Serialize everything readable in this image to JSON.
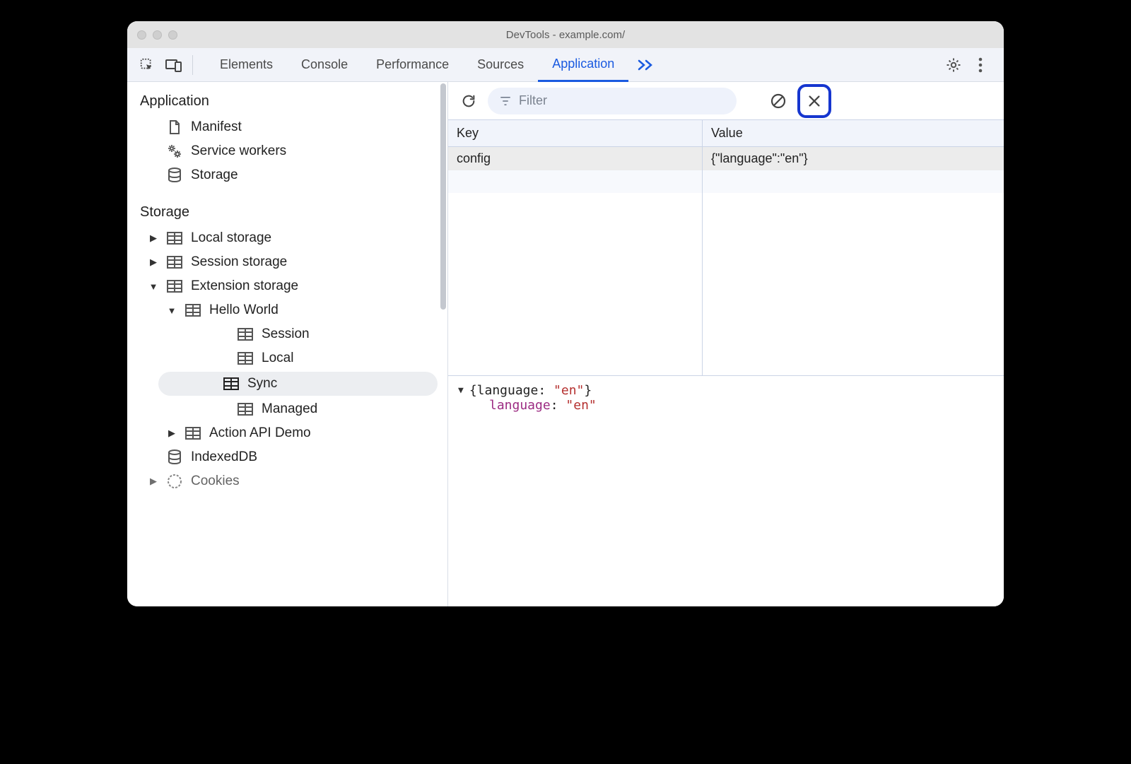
{
  "window": {
    "title": "DevTools - example.com/"
  },
  "tabs": {
    "items": [
      "Elements",
      "Console",
      "Performance",
      "Sources",
      "Application"
    ],
    "active": "Application"
  },
  "sidebar": {
    "sections": {
      "application": {
        "title": "Application",
        "items": [
          {
            "label": "Manifest"
          },
          {
            "label": "Service workers"
          },
          {
            "label": "Storage"
          }
        ]
      },
      "storage": {
        "title": "Storage",
        "local_storage": "Local storage",
        "session_storage": "Session storage",
        "extension_storage": "Extension storage",
        "hello_world": "Hello World",
        "session": "Session",
        "local": "Local",
        "sync": "Sync",
        "managed": "Managed",
        "action_api_demo": "Action API Demo",
        "indexeddb": "IndexedDB",
        "cookies": "Cookies"
      }
    }
  },
  "toolbar": {
    "filter_placeholder": "Filter"
  },
  "table": {
    "headers": {
      "key": "Key",
      "value": "Value"
    },
    "rows": [
      {
        "key": "config",
        "value": "{\"language\":\"en\"}"
      }
    ]
  },
  "detail": {
    "summary_prefix": "{language: ",
    "summary_value": "\"en\"",
    "summary_suffix": "}",
    "key": "language",
    "sep": ": ",
    "value": "\"en\""
  }
}
